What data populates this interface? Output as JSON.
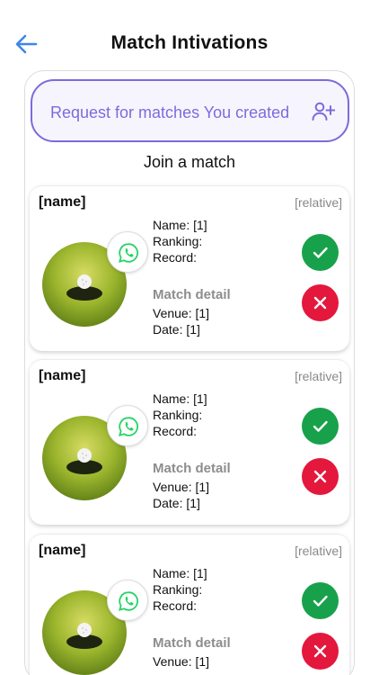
{
  "header": {
    "title": "Match Intivations",
    "back_icon": "arrow-left-icon"
  },
  "request_button": {
    "label": "Request for matches You created",
    "icon": "add-user-icon",
    "accent": "#7b6cdc"
  },
  "section_title": "Join a match",
  "colors": {
    "accept": "#18a14b",
    "reject": "#e4173d",
    "whatsapp": "#25d366"
  },
  "cards": [
    {
      "name": "[name]",
      "relative": "[relative]",
      "name_line": "Name: [1]",
      "ranking": "Ranking:",
      "record": "Record:",
      "detail_heading": "Match detail",
      "venue": "Venue: [1]",
      "date": "Date: [1]"
    },
    {
      "name": "[name]",
      "relative": "[relative]",
      "name_line": "Name: [1]",
      "ranking": "Ranking:",
      "record": "Record:",
      "detail_heading": "Match detail",
      "venue": "Venue: [1]",
      "date": "Date: [1]"
    },
    {
      "name": "[name]",
      "relative": "[relative]",
      "name_line": "Name: [1]",
      "ranking": "Ranking:",
      "record": "Record:",
      "detail_heading": "Match detail",
      "venue": "Venue: [1]",
      "date": ""
    }
  ]
}
